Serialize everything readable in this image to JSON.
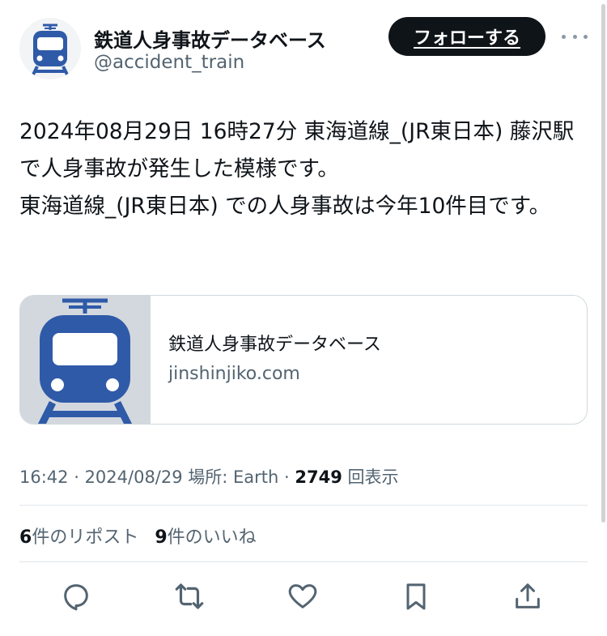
{
  "account": {
    "display_name": "鉄道人身事故データベース",
    "handle": "@accident_train",
    "follow_label": "フォローする"
  },
  "tweet": {
    "text": "2024年08月29日 16時27分 東海道線_(JR東日本) 藤沢駅で人身事故が発生した模様です。\n東海道線_(JR東日本) での人身事故は今年10件目です。"
  },
  "card": {
    "title": "鉄道人身事故データベース",
    "domain": "jinshinjiko.com"
  },
  "meta": {
    "time": "16:42",
    "sep1": " · ",
    "date": "2024/08/29",
    "location_label": " 場所: Earth",
    "sep2": " · ",
    "views_count": "2749",
    "views_label": " 回表示"
  },
  "stats": {
    "reposts_count": "6",
    "reposts_label": "件のリポスト",
    "likes_count": "9",
    "likes_label": "件のいいね"
  },
  "icons": {
    "avatar": "train-icon",
    "card_thumb": "train-icon",
    "more": "more-icon",
    "reply": "reply-icon",
    "repost": "repost-icon",
    "like": "heart-icon",
    "bookmark": "bookmark-icon",
    "share": "share-icon"
  },
  "colors": {
    "brand_train": "#2f5aa8",
    "follow_bg": "#0f1419",
    "muted_text": "#536471",
    "icon_gray": "#536471"
  }
}
